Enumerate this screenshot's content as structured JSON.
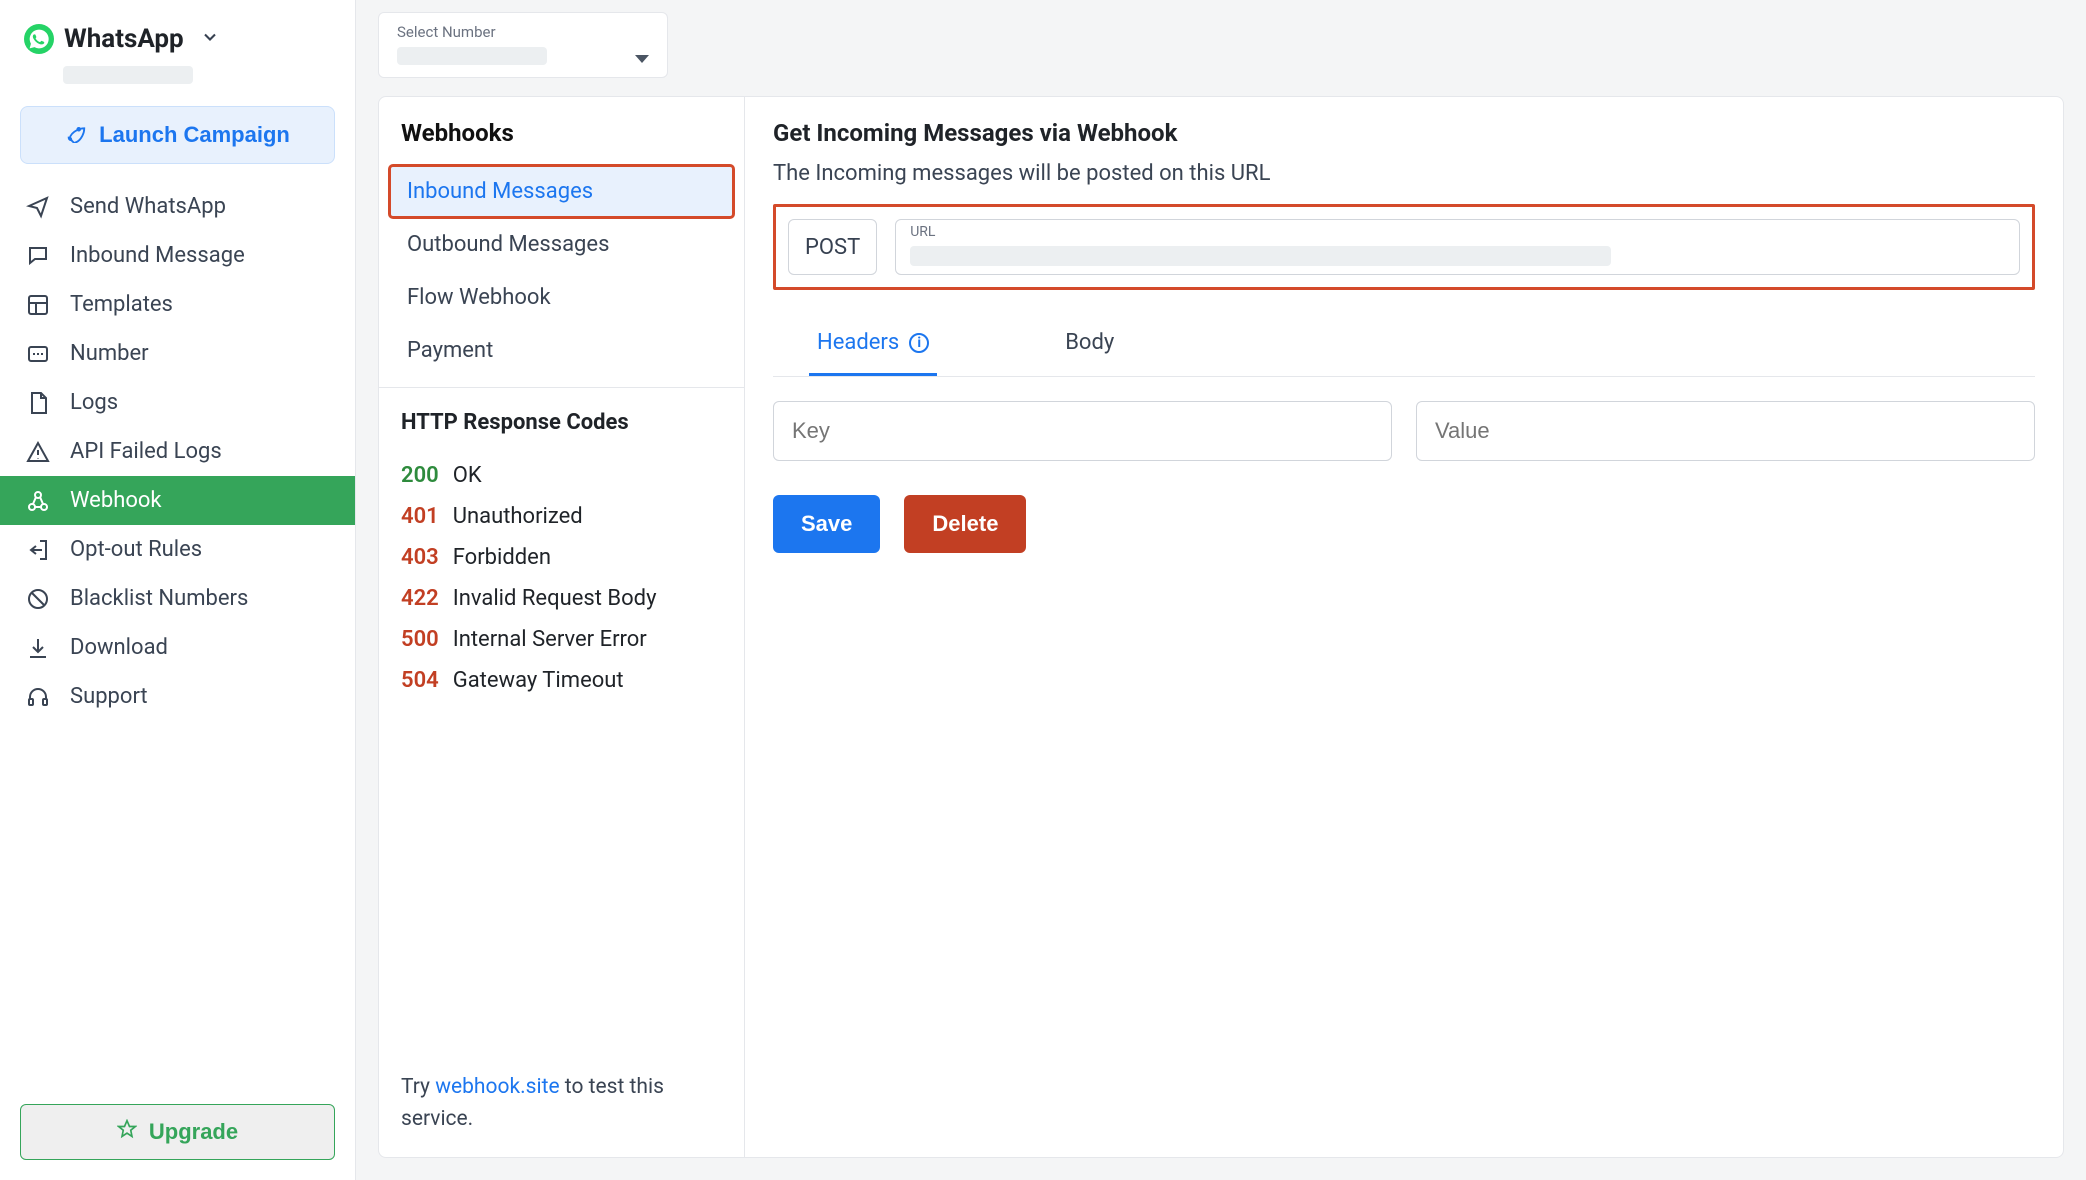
{
  "brand": {
    "name": "WhatsApp"
  },
  "launch_label": "Launch Campaign",
  "sidebar": {
    "items": [
      {
        "label": "Send WhatsApp",
        "icon": "paper-plane-icon"
      },
      {
        "label": "Inbound Message",
        "icon": "chat-icon"
      },
      {
        "label": "Templates",
        "icon": "layout-icon"
      },
      {
        "label": "Number",
        "icon": "number-icon"
      },
      {
        "label": "Logs",
        "icon": "file-icon"
      },
      {
        "label": "API Failed Logs",
        "icon": "warning-icon"
      },
      {
        "label": "Webhook",
        "icon": "webhook-icon",
        "active": true
      },
      {
        "label": "Opt-out Rules",
        "icon": "exit-icon"
      },
      {
        "label": "Blacklist Numbers",
        "icon": "ban-icon"
      },
      {
        "label": "Download",
        "icon": "download-icon"
      },
      {
        "label": "Support",
        "icon": "headphones-icon"
      }
    ],
    "upgrade_label": "Upgrade"
  },
  "number_select": {
    "label": "Select Number",
    "value_masked": true
  },
  "webhooks": {
    "title": "Webhooks",
    "items": [
      {
        "label": "Inbound Messages",
        "active": true
      },
      {
        "label": "Outbound Messages"
      },
      {
        "label": "Flow Webhook"
      },
      {
        "label": "Payment"
      }
    ],
    "codes_title": "HTTP Response Codes",
    "codes": [
      {
        "code": "200",
        "desc": "OK",
        "color": "green"
      },
      {
        "code": "401",
        "desc": "Unauthorized",
        "color": "red"
      },
      {
        "code": "403",
        "desc": "Forbidden",
        "color": "red"
      },
      {
        "code": "422",
        "desc": "Invalid Request Body",
        "color": "red"
      },
      {
        "code": "500",
        "desc": "Internal Server Error",
        "color": "red"
      },
      {
        "code": "504",
        "desc": "Gateway Timeout",
        "color": "red"
      }
    ],
    "foot_prefix": "Try ",
    "foot_link": "webhook.site",
    "foot_suffix": " to test this service."
  },
  "right": {
    "title": "Get Incoming Messages via Webhook",
    "desc": "The Incoming messages will be posted on this URL",
    "method": "POST",
    "url_label": "URL",
    "url_value_masked": true,
    "tabs": [
      {
        "label": "Headers",
        "active": true,
        "info": true
      },
      {
        "label": "Body"
      }
    ],
    "key_placeholder": "Key",
    "value_placeholder": "Value",
    "save_label": "Save",
    "delete_label": "Delete"
  }
}
